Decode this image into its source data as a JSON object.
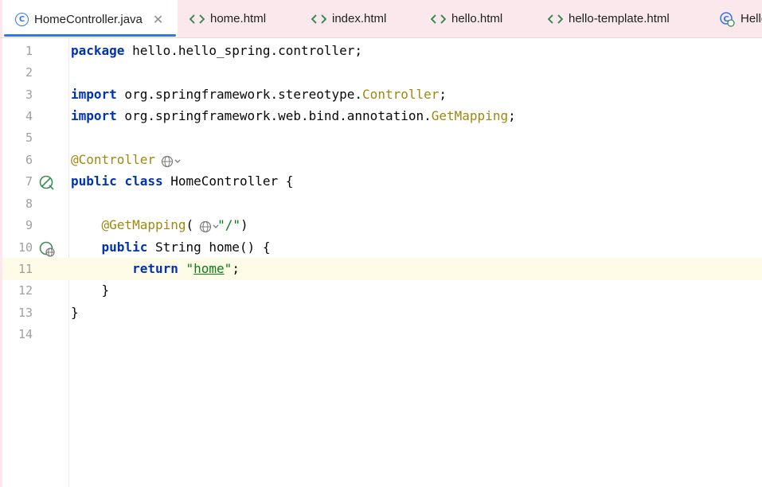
{
  "tabs": [
    {
      "label": "HomeController.java",
      "icon": "java-class-icon",
      "active": true,
      "closable": true
    },
    {
      "label": "home.html",
      "icon": "html-file-icon"
    },
    {
      "label": "index.html",
      "icon": "html-file-icon"
    },
    {
      "label": "hello.html",
      "icon": "html-file-icon"
    },
    {
      "label": "hello-template.html",
      "icon": "html-file-icon"
    },
    {
      "label": "Hello",
      "icon": "java-class-icon"
    }
  ],
  "tab_close_glyph": "✕",
  "html_icon_glyph": "<>",
  "class_icon_glyph": "C",
  "colors": {
    "tab_bar_bg": "#fbe8ec",
    "active_tab_underline": "#3574f0",
    "keyword": "#0033b3",
    "annotation": "#9e880d",
    "string": "#067d17",
    "current_line": "#fefbe6",
    "line_number": "#a0a0a0"
  },
  "editor": {
    "line_numbers": [
      "1",
      "2",
      "3",
      "4",
      "5",
      "6",
      "7",
      "8",
      "9",
      "10",
      "11",
      "12",
      "13",
      "14"
    ],
    "current_line": "11",
    "lines": [
      [
        {
          "t": "package",
          "k": "kw"
        },
        {
          "t": " hello.hello_spring.controller;"
        }
      ],
      [],
      [
        {
          "t": "import",
          "k": "kw"
        },
        {
          "t": " org.springframework.stereotype."
        },
        {
          "t": "Controller",
          "k": "cls"
        },
        {
          "t": ";"
        }
      ],
      [
        {
          "t": "import",
          "k": "kw"
        },
        {
          "t": " org.springframework.web.bind.annotation."
        },
        {
          "t": "GetMapping",
          "k": "cls"
        },
        {
          "t": ";"
        }
      ],
      [],
      [
        {
          "t": "@Controller",
          "k": "ann"
        }
      ],
      [
        {
          "t": "public",
          "k": "kw"
        },
        {
          "t": " "
        },
        {
          "t": "class",
          "k": "kw"
        },
        {
          "t": " HomeController {"
        }
      ],
      [],
      [
        {
          "t": "    "
        },
        {
          "t": "@GetMapping",
          "k": "ann"
        },
        {
          "t": "("
        },
        {
          "t": "\"/\"",
          "k": "str"
        },
        {
          "t": ")"
        }
      ],
      [
        {
          "t": "    "
        },
        {
          "t": "public",
          "k": "kw"
        },
        {
          "t": " String home() {"
        }
      ],
      [
        {
          "t": "        "
        },
        {
          "t": "return",
          "k": "kw"
        },
        {
          "t": " "
        },
        {
          "t": "\"",
          "k": "str"
        },
        {
          "t": "home",
          "k": "str-u"
        },
        {
          "t": "\"",
          "k": "str"
        },
        {
          "t": ";"
        }
      ],
      [
        {
          "t": "    }"
        }
      ],
      [
        {
          "t": "}"
        }
      ],
      []
    ]
  }
}
